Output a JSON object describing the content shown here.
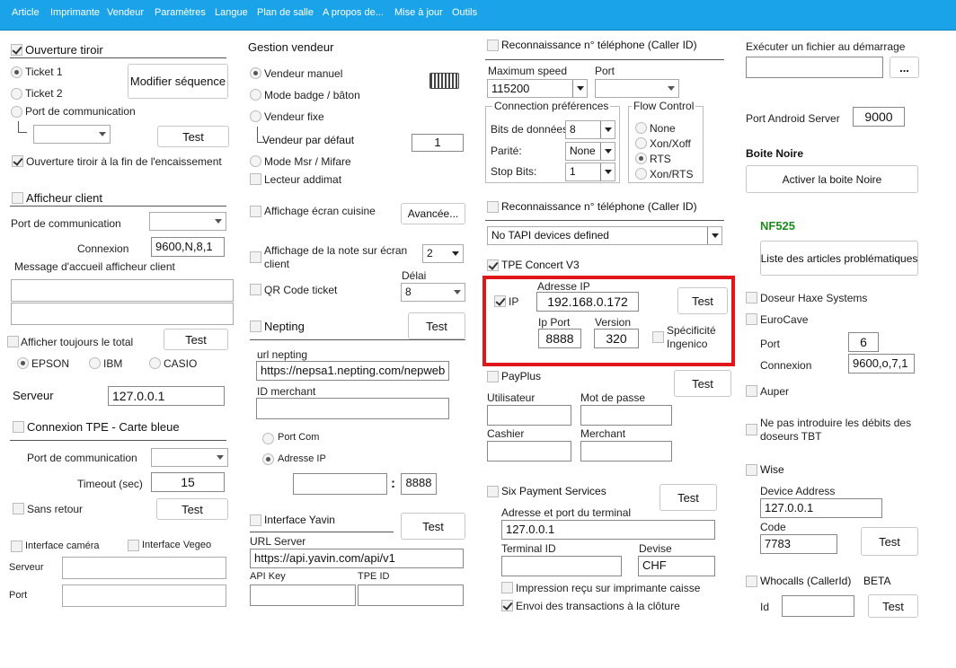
{
  "menu": [
    "Article",
    "Imprimante",
    "Vendeur",
    "Paramètres",
    "Langue",
    "Plan de salle",
    "A propos de...",
    "Mise à jour",
    "Outils"
  ],
  "col1": {
    "tiroir": {
      "title": "Ouverture tiroir",
      "ticket1": "Ticket 1",
      "ticket2": "Ticket 2",
      "port_com": "Port de communication",
      "modifier_btn": "Modifier séquence",
      "test_btn": "Test",
      "fin": "Ouverture tiroir à la fin de l'encaissement"
    },
    "afficheur": {
      "title": "Afficheur client",
      "port_com": "Port de communication",
      "connexion": "Connexion",
      "connexion_value": "9600,N,8,1",
      "message": "Message d'accueil afficheur client",
      "toujours": "Afficher toujours le total",
      "test_btn": "Test",
      "epson": "EPSON",
      "ibm": "IBM",
      "casio": "CASIO"
    },
    "serveur": {
      "label": "Serveur",
      "value": "127.0.0.1"
    },
    "tpe": {
      "title": "Connexion TPE - Carte bleue",
      "port_com": "Port de communication",
      "timeout": "Timeout (sec)",
      "timeout_value": "15",
      "sans_retour": "Sans retour",
      "test_btn": "Test"
    },
    "camera": {
      "interface_camera": "Interface caméra",
      "interface_vegeo": "Interface Vegeo",
      "serveur": "Serveur",
      "port": "Port"
    }
  },
  "col2": {
    "vendeur": {
      "title": "Gestion vendeur",
      "manuel": "Vendeur manuel",
      "badge": "Mode badge / bâton",
      "fixe": "Vendeur fixe",
      "defaut": "Vendeur par défaut",
      "defaut_value": "1",
      "msr": "Mode Msr / Mifare",
      "addimat": "Lecteur addimat"
    },
    "cuisine": {
      "label": "Affichage écran cuisine",
      "avancee_btn": "Avancée..."
    },
    "note": {
      "label": "Affichage de la note sur écran client",
      "value": "2"
    },
    "qr": {
      "label": "QR Code ticket",
      "delai": "Délai",
      "delai_value": "8"
    },
    "nepting": {
      "title": "Nepting",
      "test_btn": "Test",
      "url_label": "url nepting",
      "url_value": "https://nepsa1.nepting.com/nepweb",
      "merchant_label": "ID merchant",
      "port_com": "Port Com",
      "adresse_ip": "Adresse IP",
      "colon": ":",
      "port_value": "8888"
    },
    "yavin": {
      "title": "Interface Yavin",
      "test_btn": "Test",
      "url_label": "URL Server",
      "url_value": "https://api.yavin.com/api/v1",
      "api_key": "API Key",
      "tpe_id": "TPE ID"
    }
  },
  "col3": {
    "caller1": {
      "title": "Reconnaissance n° téléphone (Caller ID)",
      "max_speed": "Maximum speed",
      "max_speed_value": "115200",
      "port": "Port",
      "conn_pref": "Connection préférences",
      "bits": "Bits de données",
      "bits_value": "8",
      "parite": "Parité:",
      "parite_value": "None",
      "stop": "Stop Bits:",
      "stop_value": "1",
      "flow": "Flow Control",
      "none": "None",
      "xon": "Xon/Xoff",
      "rts": "RTS",
      "xonrts": "Xon/RTS"
    },
    "caller2": {
      "title": "Reconnaissance n° téléphone (Caller ID)",
      "tapi_value": "No TAPI devices defined"
    },
    "concert": {
      "title": "TPE Concert V3",
      "ip": "IP",
      "adresse_ip": "Adresse IP",
      "ip_value": "192.168.0.172",
      "test_btn": "Test",
      "ip_port": "Ip Port",
      "ip_port_value": "8888",
      "version": "Version",
      "version_value": "320",
      "ingenico": "Spécificité Ingenico"
    },
    "payplus": {
      "title": "PayPlus",
      "test_btn": "Test",
      "utilisateur": "Utilisateur",
      "mdp": "Mot de passe",
      "caissier": "Cashier",
      "merchant": "Merchant"
    },
    "six": {
      "title": "Six Payment Services",
      "test_btn": "Test",
      "adresse": "Adresse et port du terminal",
      "adresse_value": "127.0.0.1",
      "terminal_id": "Terminal ID",
      "devise": "Devise",
      "devise_value": "CHF",
      "impression": "Impression reçu sur imprimante caisse",
      "envoi": "Envoi des transactions à la clôture"
    }
  },
  "col4": {
    "executer": "Exécuter un fichier au démarrage",
    "browse_btn": "...",
    "android": "Port Android Server",
    "android_value": "9000",
    "boite_noire": "Boite Noire",
    "activer_btn": "Activer la boite Noire",
    "nf525": "NF525",
    "liste_btn": "Liste des articles problématiques",
    "haxe": "Doseur Haxe Systems",
    "eurocave": "EuroCave",
    "port": "Port",
    "port_value": "6",
    "connexion": "Connexion",
    "connexion_value": "9600,o,7,1",
    "auper": "Auper",
    "debits": "Ne pas introduire les débits des doseurs TBT",
    "wise": "Wise",
    "device_address": "Device Address",
    "device_value": "127.0.0.1",
    "code": "Code",
    "code_value": "7783",
    "test_btn": "Test",
    "whocalls": "Whocalls (CallerId)",
    "beta": "BETA",
    "id": "Id",
    "test_btn2": "Test"
  },
  "colors": {
    "menubar": "#1aa3e8",
    "highlight": "#e0161b",
    "nf525": "#1c8a1c"
  }
}
